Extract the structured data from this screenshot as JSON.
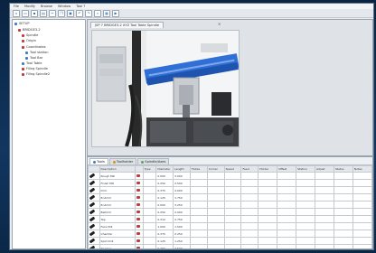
{
  "app": {
    "menu": [
      "File",
      "Modify",
      "Browse",
      "Window",
      "Tool ?"
    ]
  },
  "toolbar": {
    "icons": [
      "new-icon",
      "open-icon",
      "save-icon",
      "print-icon",
      "cut-icon",
      "copy-icon",
      "paste-icon",
      "undo-icon",
      "redo-icon",
      "zoom-icon",
      "grid-icon",
      "run-icon"
    ]
  },
  "tree": {
    "items": [
      "SETUP",
      "BRIDGE3-2",
      "Spindle",
      "Origin",
      "Coordinates",
      "Tool station",
      "Tool Bar",
      "Tool Table",
      "Filing Spindle",
      "Filing Spindle2"
    ]
  },
  "viewer": {
    "tab_label": "JSP 7 BRIDGE3-2 XYZ Tool Table Spindle",
    "close_glyph": "×",
    "image_alt": "CNC machine with blue spindle assembly"
  },
  "grid": {
    "tabs": [
      "Tools",
      "Toolholder",
      "Spindle/Axes"
    ],
    "tab_colors": [
      "#3b7bd0",
      "#d98a2b",
      "#5aa35a"
    ],
    "columns": [
      "",
      "Description",
      "",
      "Type",
      "Diameter",
      "Length",
      "Flutes",
      "Corner",
      "Speed",
      "Feed",
      "Holder",
      "Offset",
      "Station",
      "Adjust",
      "Status",
      "Notes"
    ],
    "rows": [
      [
        "Rough Mill",
        "0.500",
        "3.000"
      ],
      [
        "Finish Mill",
        "0.250",
        "2.500"
      ],
      [
        "Drill",
        "0.375",
        "4.000"
      ],
      [
        "Endmill",
        "0.125",
        "1.750"
      ],
      [
        "Endmill",
        "0.500",
        "3.250"
      ],
      [
        "Ballmill",
        "0.250",
        "2.000"
      ],
      [
        "Tap",
        "0.312",
        "2.750"
      ],
      [
        "Face Mill",
        "1.000",
        "1.500"
      ],
      [
        "Chamfer",
        "0.375",
        "2.250"
      ],
      [
        "Spot Drill",
        "0.125",
        "1.250"
      ],
      [
        "Reamer",
        "0.250",
        "3.500"
      ],
      [
        "Boring Bar",
        "0.750",
        "4.500"
      ]
    ]
  }
}
